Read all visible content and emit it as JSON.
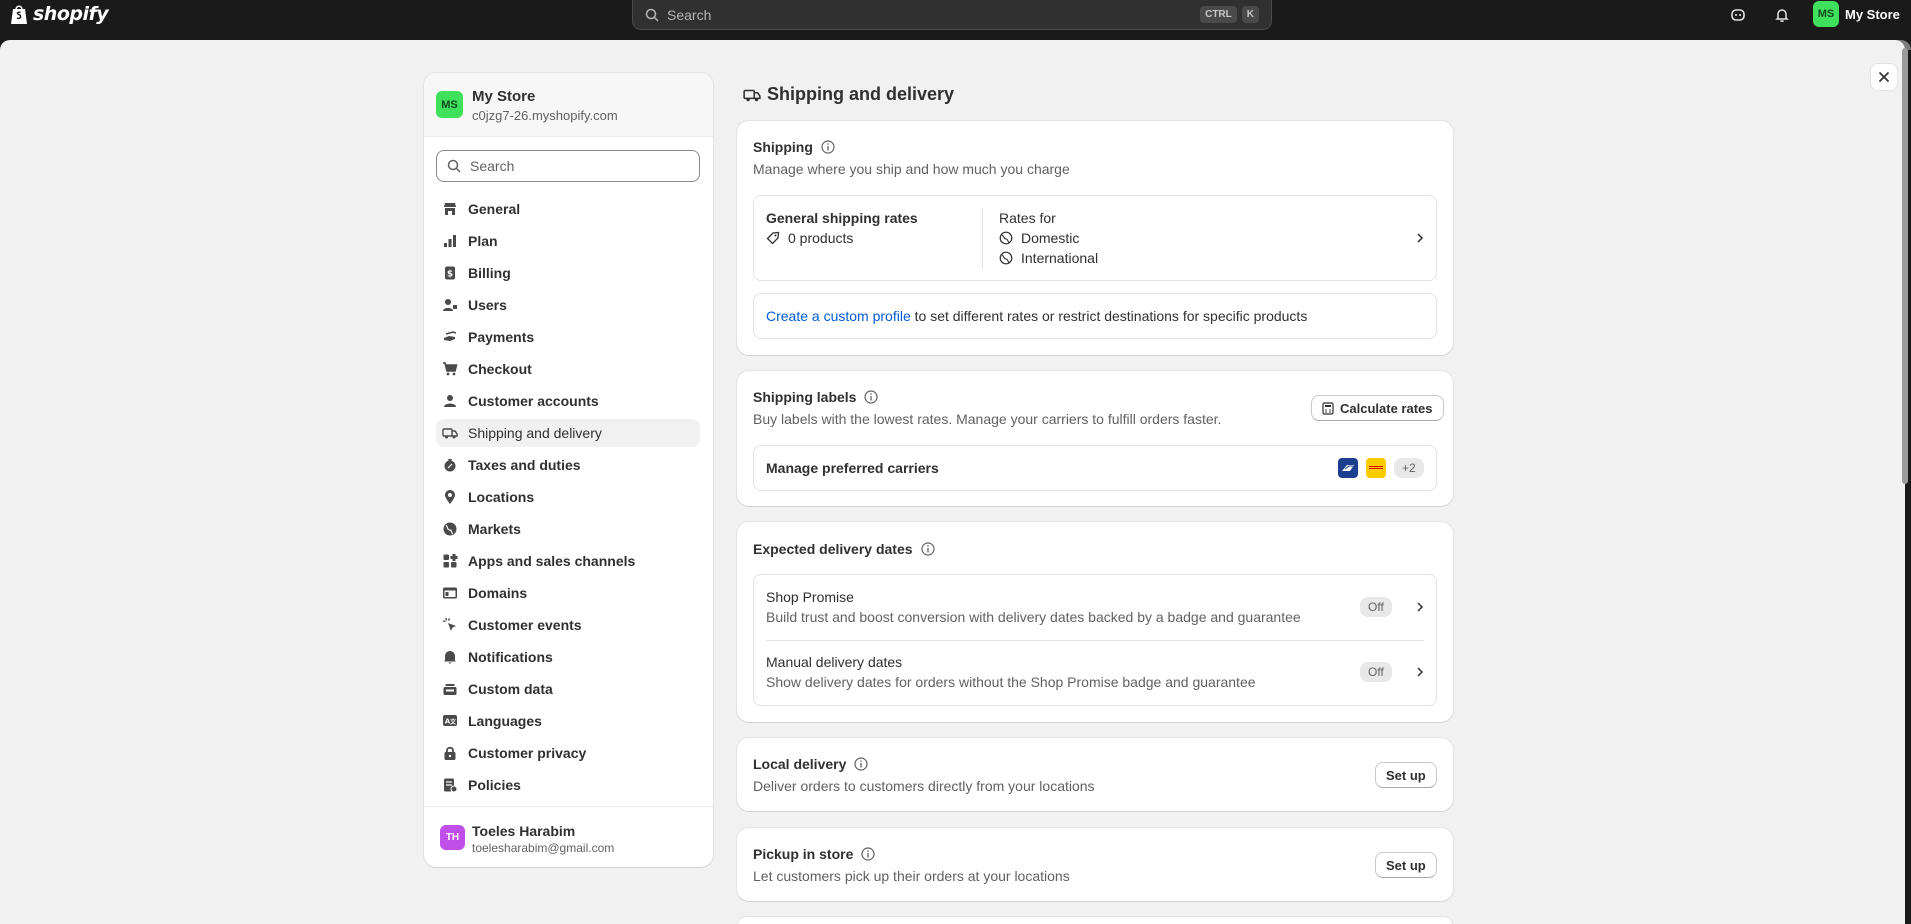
{
  "topbar": {
    "logo_text": "shopify",
    "search_placeholder": "Search",
    "kbd_ctrl": "CTRL",
    "kbd_k": "K",
    "store_initials": "MS",
    "store_label": "My Store"
  },
  "sidebar": {
    "store_initials": "MS",
    "store_name": "My Store",
    "store_domain": "c0jzg7-26.myshopify.com",
    "search_placeholder": "Search",
    "items": [
      {
        "label": "General",
        "icon": "store-icon"
      },
      {
        "label": "Plan",
        "icon": "plan-icon"
      },
      {
        "label": "Billing",
        "icon": "billing-icon"
      },
      {
        "label": "Users",
        "icon": "users-icon"
      },
      {
        "label": "Payments",
        "icon": "payments-icon"
      },
      {
        "label": "Checkout",
        "icon": "cart-icon"
      },
      {
        "label": "Customer accounts",
        "icon": "person-icon"
      },
      {
        "label": "Shipping and delivery",
        "icon": "truck-icon",
        "active": true
      },
      {
        "label": "Taxes and duties",
        "icon": "tax-icon"
      },
      {
        "label": "Locations",
        "icon": "location-icon"
      },
      {
        "label": "Markets",
        "icon": "globe-icon"
      },
      {
        "label": "Apps and sales channels",
        "icon": "apps-icon"
      },
      {
        "label": "Domains",
        "icon": "domains-icon"
      },
      {
        "label": "Customer events",
        "icon": "cursor-icon"
      },
      {
        "label": "Notifications",
        "icon": "bell-icon"
      },
      {
        "label": "Custom data",
        "icon": "data-icon"
      },
      {
        "label": "Languages",
        "icon": "language-icon"
      },
      {
        "label": "Customer privacy",
        "icon": "lock-icon"
      },
      {
        "label": "Policies",
        "icon": "policies-icon"
      }
    ],
    "user_initials": "TH",
    "user_name": "Toeles Harabim",
    "user_email": "toelesharabim@gmail.com"
  },
  "main": {
    "page_title": "Shipping and delivery",
    "shipping": {
      "title": "Shipping",
      "subtitle": "Manage where you ship and how much you charge",
      "general_rates_title": "General shipping rates",
      "products_count": "0 products",
      "rates_for_label": "Rates for",
      "zones": [
        "Domestic",
        "International"
      ],
      "custom_profile_link": "Create a custom profile",
      "custom_profile_rest": " to set different rates or restrict destinations for specific products"
    },
    "labels": {
      "title": "Shipping labels",
      "subtitle": "Buy labels with the lowest rates. Manage your carriers to fulfill orders faster.",
      "calculate_button": "Calculate rates",
      "carriers_label": "Manage preferred carriers",
      "more_carriers": "+2"
    },
    "delivery_dates": {
      "title": "Expected delivery dates",
      "items": [
        {
          "title": "Shop Promise",
          "desc": "Build trust and boost conversion with delivery dates backed by a badge and guarantee",
          "status": "Off"
        },
        {
          "title": "Manual delivery dates",
          "desc": "Show delivery dates for orders without the Shop Promise badge and guarantee",
          "status": "Off"
        }
      ]
    },
    "local_delivery": {
      "title": "Local delivery",
      "subtitle": "Deliver orders to customers directly from your locations",
      "button": "Set up"
    },
    "pickup": {
      "title": "Pickup in store",
      "subtitle": "Let customers pick up their orders at your locations",
      "button": "Set up"
    }
  },
  "colors": {
    "topbar": "#1a1a1a",
    "canvas": "#f1f1f1",
    "link": "#005bd3",
    "store_avatar": "#3ee05c",
    "user_avatar": "#c04ee8"
  }
}
